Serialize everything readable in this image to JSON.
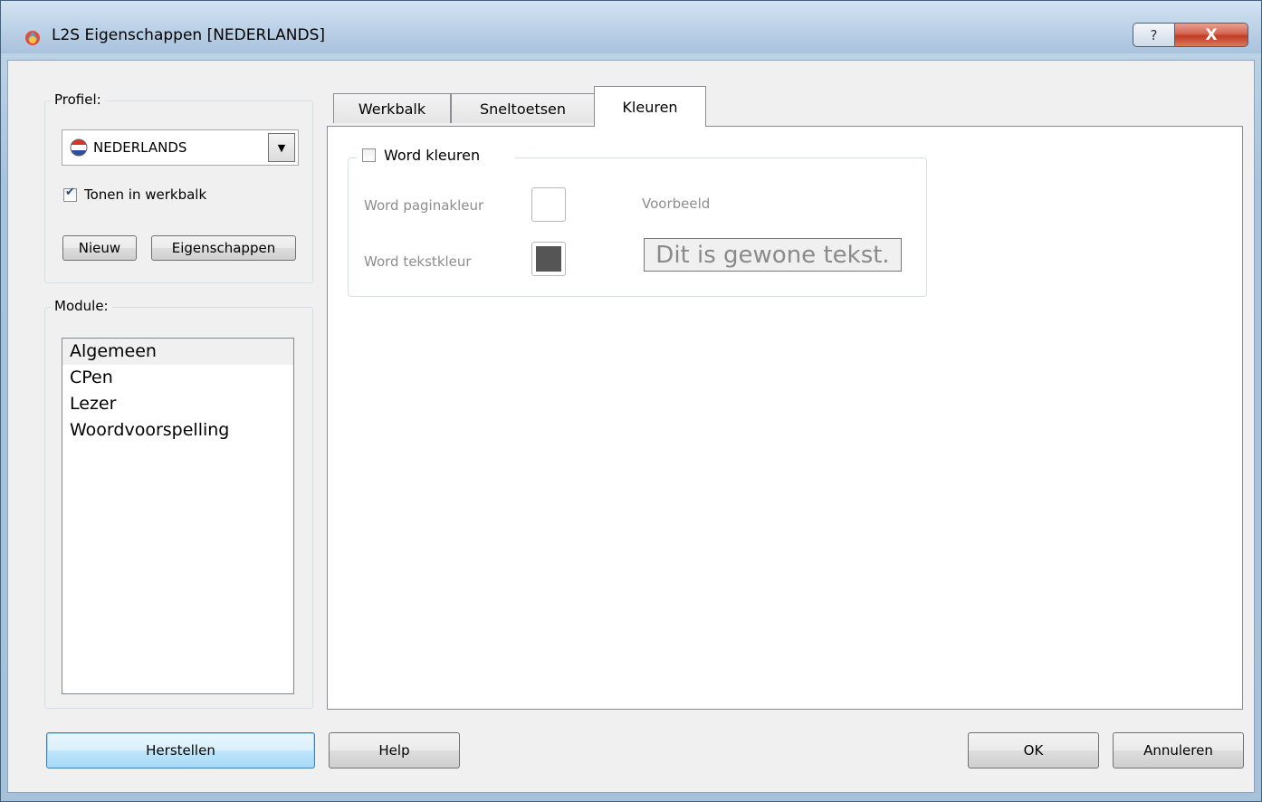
{
  "window": {
    "title": "L2S Eigenschappen [NEDERLANDS]",
    "help_glyph": "?",
    "close_glyph": "X"
  },
  "profile": {
    "group_label": "Profiel:",
    "selected": "NEDERLANDS",
    "dropdown_arrow": "▼",
    "show_in_toolbar_label": "Tonen in werkbalk",
    "show_in_toolbar_checked": true,
    "new_button": "Nieuw",
    "properties_button": "Eigenschappen"
  },
  "modules": {
    "group_label": "Module:",
    "items": [
      "Algemeen",
      "CPen",
      "Lezer",
      "Woordvoorspelling"
    ],
    "selected_index": 0
  },
  "tabs": [
    {
      "label": "Werkbalk",
      "active": false
    },
    {
      "label": "Sneltoetsen",
      "active": false
    },
    {
      "label": "Kleuren",
      "active": true
    }
  ],
  "colors_tab": {
    "word_colors_label": "Word kleuren",
    "word_colors_checked": false,
    "page_color_label": "Word paginakleur",
    "page_color": "#ffffff",
    "text_color_label": "Word tekstkleur",
    "text_color": "#555555",
    "preview_label": "Voorbeeld",
    "preview_text": "Dit is gewone tekst."
  },
  "buttons": {
    "restore": "Herstellen",
    "help": "Help",
    "ok": "OK",
    "cancel": "Annuleren"
  }
}
